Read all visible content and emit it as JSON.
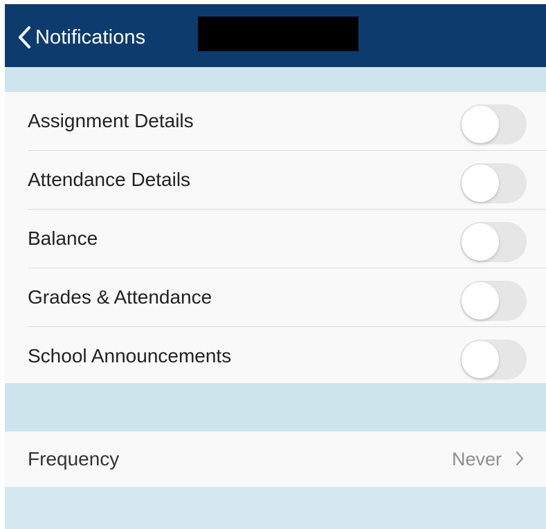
{
  "navbar": {
    "back_label": "Notifications",
    "back_icon": "chevron-left-icon",
    "background_color": "#0d3b6e"
  },
  "notifications": {
    "items": [
      {
        "label": "Assignment Details",
        "enabled": false
      },
      {
        "label": "Attendance Details",
        "enabled": false
      },
      {
        "label": "Balance",
        "enabled": false
      },
      {
        "label": "Grades & Attendance",
        "enabled": false
      },
      {
        "label": "School Announcements",
        "enabled": false
      }
    ]
  },
  "frequency": {
    "label": "Frequency",
    "value": "Never",
    "chevron_icon": "chevron-right-icon"
  },
  "colors": {
    "section_background": "#d4e8f0",
    "row_background": "#f9f9f9",
    "toggle_off": "#e6e6e6"
  }
}
